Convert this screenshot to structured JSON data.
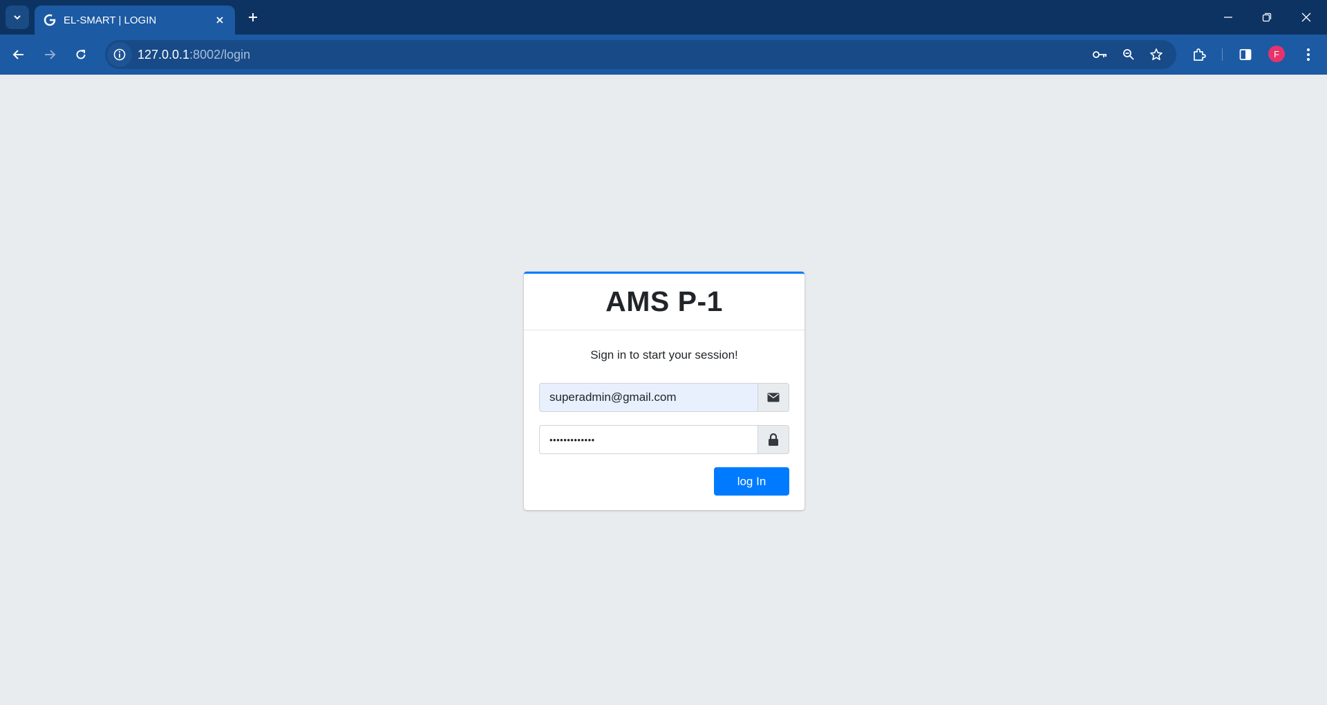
{
  "browser": {
    "tab_title": "EL-SMART | LOGIN",
    "url_host": "127.0.0.1",
    "url_path": ":8002/login",
    "profile_initial": "F"
  },
  "login": {
    "title": "AMS P-1",
    "message": "Sign in to start your session!",
    "email_value": "superadmin@gmail.com",
    "password_masked": "•••••••••••••",
    "submit_label": "log In"
  },
  "colors": {
    "primary": "#007bff",
    "page_bg": "#e9ecef",
    "chrome_dark": "#0d3362",
    "chrome_toolbar": "#1c5aa3",
    "profile_bg": "#e8336a"
  }
}
